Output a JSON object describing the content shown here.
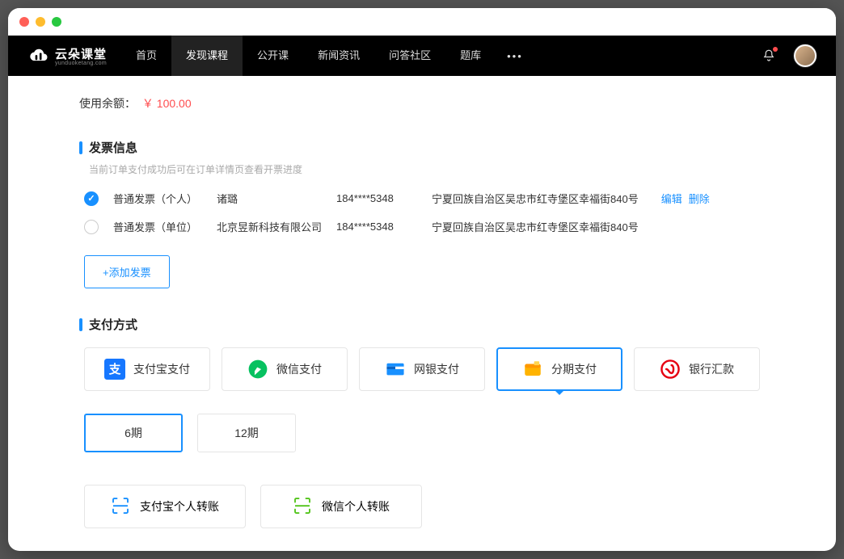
{
  "brand": {
    "name": "云朵课堂",
    "sub": "yunduoketang.com"
  },
  "nav": {
    "items": [
      "首页",
      "发现课程",
      "公开课",
      "新闻资讯",
      "问答社区",
      "题库"
    ],
    "active_index": 1
  },
  "balance": {
    "label": "使用余额：",
    "amount": "￥ 100.00"
  },
  "invoice_section": {
    "title": "发票信息",
    "sub": "当前订单支付成功后可在订单详情页查看开票进度",
    "rows": [
      {
        "checked": true,
        "type": "普通发票（个人）",
        "name": "诸璐",
        "phone": "184****5348",
        "addr": "宁夏回族自治区吴忠市红寺堡区幸福街840号",
        "edit": "编辑",
        "del": "删除"
      },
      {
        "checked": false,
        "type": "普通发票（单位）",
        "name": "北京昱新科技有限公司",
        "phone": "184****5348",
        "addr": "宁夏回族自治区吴忠市红寺堡区幸福街840号"
      }
    ],
    "add_label": "+添加发票"
  },
  "pay_section": {
    "title": "支付方式",
    "methods": [
      {
        "key": "alipay",
        "label": "支付宝支付"
      },
      {
        "key": "wechat",
        "label": "微信支付"
      },
      {
        "key": "bank",
        "label": "网银支付"
      },
      {
        "key": "install",
        "label": "分期支付",
        "selected": true
      },
      {
        "key": "remit",
        "label": "银行汇款"
      }
    ],
    "installments": [
      {
        "label": "6期",
        "selected": true
      },
      {
        "label": "12期"
      }
    ],
    "transfers": [
      {
        "key": "alipay-transfer",
        "label": "支付宝个人转账",
        "color": "#1890ff"
      },
      {
        "key": "wechat-transfer",
        "label": "微信个人转账",
        "color": "#52c41a"
      }
    ]
  }
}
